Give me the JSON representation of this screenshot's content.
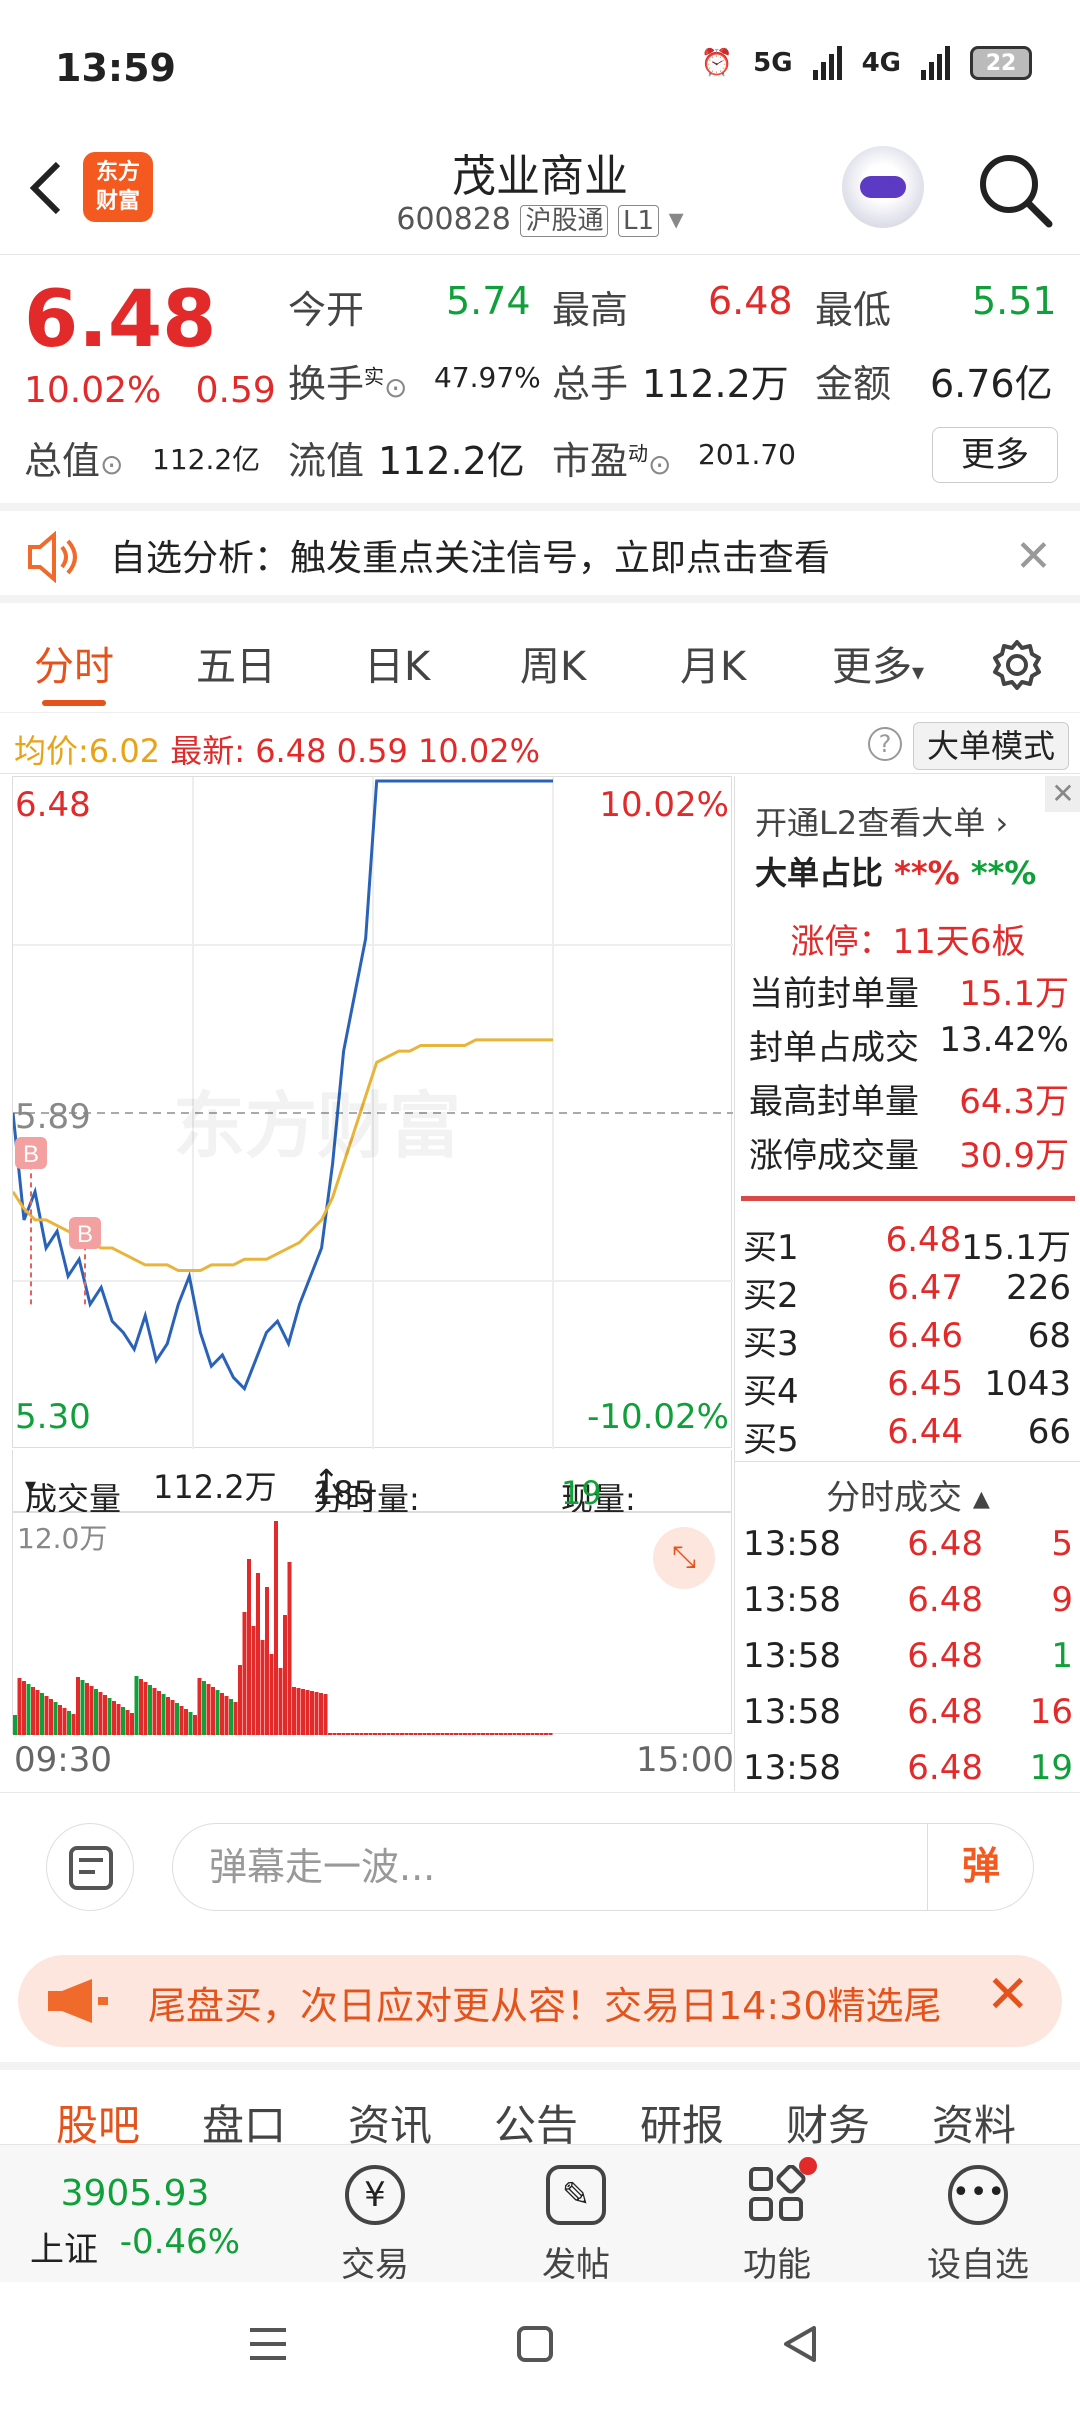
{
  "status_bar": {
    "time": "13:59",
    "net1": "5G",
    "net2": "4G",
    "battery": "22"
  },
  "header": {
    "title": "茂业商业",
    "code": "600828",
    "exchange_tag": "沪股通",
    "level_tag": "L1",
    "logo_line1": "东方",
    "logo_line2": "财富"
  },
  "quote": {
    "price": "6.48",
    "change_pct": "10.02%",
    "change": "0.59",
    "open_label": "今开",
    "open": "5.74",
    "high_label": "最高",
    "high": "6.48",
    "low_label": "最低",
    "low": "5.51",
    "turnover_label": "换手",
    "turnover_sup": "实",
    "turnover": "47.97%",
    "volume_label": "总手",
    "volume": "112.2万",
    "amount_label": "金额",
    "amount": "6.76亿",
    "mktcap_label": "总值",
    "mktcap": "112.2亿",
    "float_label": "流值",
    "float_cap": "112.2亿",
    "pe_label": "市盈",
    "pe_sup": "动",
    "pe": "201.70",
    "more": "更多"
  },
  "notice": {
    "text": "自选分析：触发重点关注信号，立即点击查看"
  },
  "tabs": [
    "分时",
    "五日",
    "日K",
    "周K",
    "月K",
    "更多"
  ],
  "infoline": {
    "avg_label": "均价:",
    "avg": "6.02",
    "last_label": "最新:",
    "last": "6.48",
    "chg": "0.59",
    "pct": "10.02%",
    "mode": "大单模式"
  },
  "chart_data": {
    "type": "line",
    "y_max": "6.48",
    "y_min": "5.30",
    "y_mid": "5.89",
    "pct_max": "10.02%",
    "pct_min": "-10.02%",
    "watermark": "东方财富",
    "ylim": [
      5.3,
      6.48
    ],
    "x_start": "09:30",
    "x_end": "15:00",
    "series": [
      {
        "values": [
          5.89,
          5.7,
          5.75,
          5.65,
          5.68,
          5.6,
          5.63,
          5.55,
          5.58,
          5.52,
          5.5,
          5.47,
          5.53,
          5.45,
          5.48,
          5.55,
          5.6,
          5.5,
          5.44,
          5.46,
          5.42,
          5.4,
          5.45,
          5.5,
          5.52,
          5.48,
          5.55,
          5.6,
          5.65,
          5.8,
          6.0,
          6.1,
          6.2,
          6.48,
          6.48,
          6.48,
          6.48,
          6.48,
          6.48,
          6.48,
          6.48,
          6.48,
          6.48,
          6.48,
          6.48,
          6.48,
          6.48,
          6.48,
          6.48,
          6.48
        ]
      },
      {
        "values": [
          5.75,
          5.72,
          5.7,
          5.7,
          5.69,
          5.68,
          5.67,
          5.66,
          5.65,
          5.65,
          5.64,
          5.63,
          5.62,
          5.62,
          5.62,
          5.61,
          5.61,
          5.61,
          5.62,
          5.62,
          5.62,
          5.63,
          5.63,
          5.63,
          5.64,
          5.65,
          5.66,
          5.68,
          5.7,
          5.74,
          5.8,
          5.86,
          5.92,
          5.98,
          5.99,
          6.0,
          6.0,
          6.01,
          6.01,
          6.01,
          6.01,
          6.01,
          6.02,
          6.02,
          6.02,
          6.02,
          6.02,
          6.02,
          6.02,
          6.02
        ]
      }
    ],
    "markers": [
      "B",
      "B"
    ]
  },
  "volume": {
    "dropdown": "成交量",
    "total": "112.2万",
    "period_label": "分时量:",
    "period": "185",
    "now_label": "现量:",
    "now": "19",
    "max_label": "12.0万"
  },
  "right_panel": {
    "l2": "开通L2查看大单",
    "ratio_label": "大单占比",
    "ratio_red": "**%",
    "ratio_green": "**%",
    "limit": "涨停：11天6板",
    "rows": [
      {
        "label": "当前封单量",
        "value": "15.1万"
      },
      {
        "label": "封单占成交",
        "value": "13.42%"
      },
      {
        "label": "最高封单量",
        "value": "64.3万"
      },
      {
        "label": "涨停成交量",
        "value": "30.9万"
      }
    ],
    "bids": [
      {
        "label": "买1",
        "price": "6.48",
        "qty": "15.1万"
      },
      {
        "label": "买2",
        "price": "6.47",
        "qty": "226"
      },
      {
        "label": "买3",
        "price": "6.46",
        "qty": "68"
      },
      {
        "label": "买4",
        "price": "6.45",
        "qty": "1043"
      },
      {
        "label": "买5",
        "price": "6.44",
        "qty": "66"
      }
    ],
    "trades_title": "分时成交",
    "trades": [
      {
        "time": "13:58",
        "price": "6.48",
        "qty": "5"
      },
      {
        "time": "13:58",
        "price": "6.48",
        "qty": "9"
      },
      {
        "time": "13:58",
        "price": "6.48",
        "qty": "1"
      },
      {
        "time": "13:58",
        "price": "6.48",
        "qty": "16"
      },
      {
        "time": "13:58",
        "price": "6.48",
        "qty": "19"
      }
    ]
  },
  "comment": {
    "placeholder": "弹幕走一波...",
    "dan": "弹"
  },
  "promo": {
    "text": "尾盘买，次日应对更从容！交易日14:30精选尾"
  },
  "bottom_tabs": [
    "股吧",
    "盘口",
    "资讯",
    "公告",
    "研报",
    "财务",
    "资料"
  ],
  "toolbar": {
    "index_value": "3905.93",
    "index_name": "上证",
    "index_pct": "-0.46%",
    "trade": "交易",
    "post": "发帖",
    "func": "功能",
    "add": "设自选"
  }
}
